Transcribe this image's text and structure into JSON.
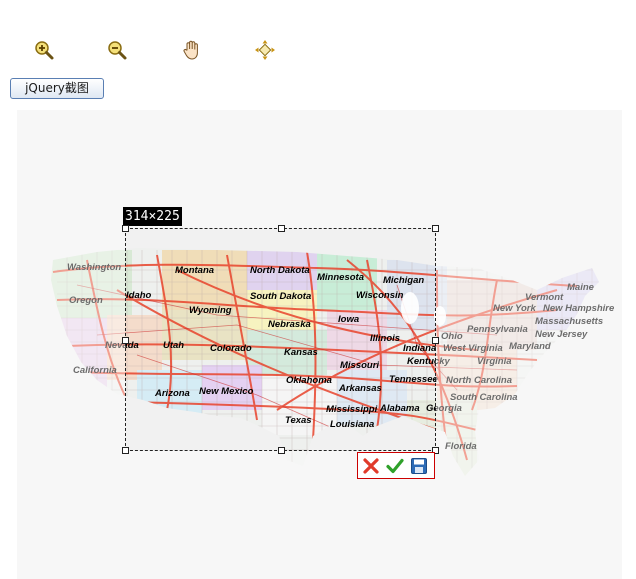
{
  "toolbar": {
    "tools": [
      {
        "name": "zoom-in",
        "icon": "zoom-in-icon"
      },
      {
        "name": "zoom-out",
        "icon": "zoom-out-icon"
      },
      {
        "name": "pan",
        "icon": "hand-icon"
      },
      {
        "name": "fit",
        "icon": "fit-arrows-icon"
      }
    ]
  },
  "crop_button": {
    "label": "jQuery截图"
  },
  "selection": {
    "size_label": "314×225"
  },
  "actions": {
    "cancel_icon": "close-icon",
    "confirm_icon": "check-icon",
    "save_icon": "save-icon"
  },
  "map": {
    "labels": [
      "Washington",
      "Montana",
      "North Dakota",
      "Minnesota",
      "Michigan",
      "Oregon",
      "Idaho",
      "South Dakota",
      "Wisconsin",
      "Wyoming",
      "Iowa",
      "Nebraska",
      "Vermont",
      "Maine",
      "New York",
      "New Hampshire",
      "Massachusetts",
      "Pennsylvania",
      "Nevada",
      "Utah",
      "Colorado",
      "Kansas",
      "Illinois",
      "Indiana",
      "Ohio",
      "West Virginia",
      "Maryland",
      "New Jersey",
      "California",
      "Missouri",
      "Kentucky",
      "Virginia",
      "Tennessee",
      "North Carolina",
      "Oklahoma",
      "Arkansas",
      "Arizona",
      "New Mexico",
      "South Carolina",
      "Mississippi",
      "Alabama",
      "Georgia",
      "Texas",
      "Louisiana",
      "Florida"
    ]
  },
  "colors": {
    "canvas_bg": "#f1f1f1",
    "road": "#e8442c",
    "cancel": "#e03a2a",
    "confirm": "#2fa12a",
    "save": "#2d6bb6"
  }
}
